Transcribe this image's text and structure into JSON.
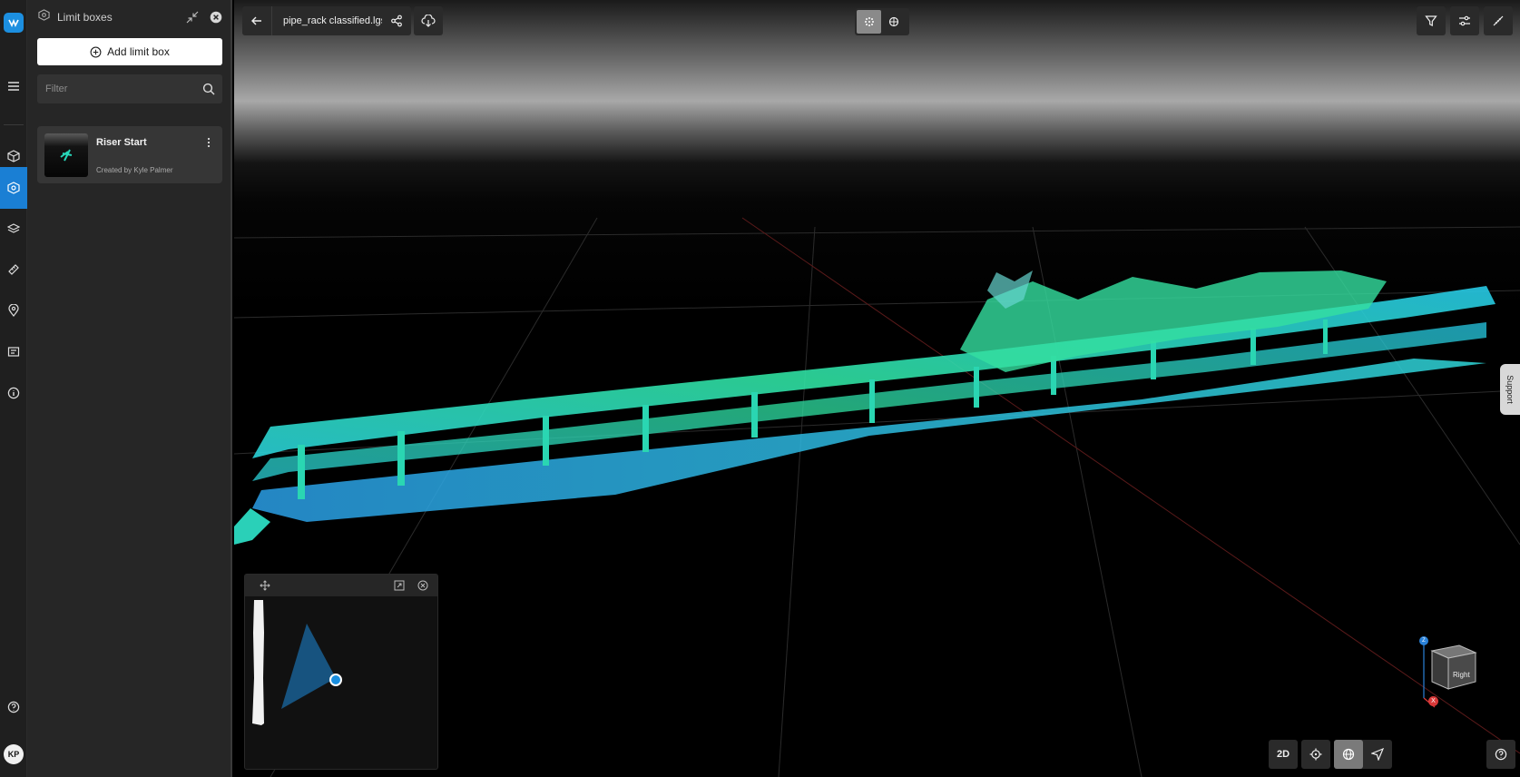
{
  "rail": {
    "items": [
      "menu",
      "models",
      "limit-boxes",
      "layers",
      "measure",
      "locations",
      "annotations",
      "info"
    ],
    "active": "limit-boxes",
    "avatar_initials": "KP"
  },
  "panel": {
    "title": "Limit boxes",
    "add_label": "Add limit box",
    "filter_placeholder": "Filter",
    "boxes": [
      {
        "name": "Riser Start",
        "creator": "Created by Kyle Palmer"
      }
    ]
  },
  "toolbar": {
    "file_name": "pipe_rack classified.lgsx"
  },
  "support_label": "Support",
  "nav_cube": {
    "face": "Right",
    "z_axis": "Z",
    "x_axis": "X"
  },
  "bottom_toolbar": {
    "mode_label": "2D"
  },
  "colors": {
    "accent": "#1a7fd4",
    "cloud_cyan": "#22d6d0",
    "cloud_green": "#35e08a",
    "cloud_blue": "#2aa5e0"
  }
}
